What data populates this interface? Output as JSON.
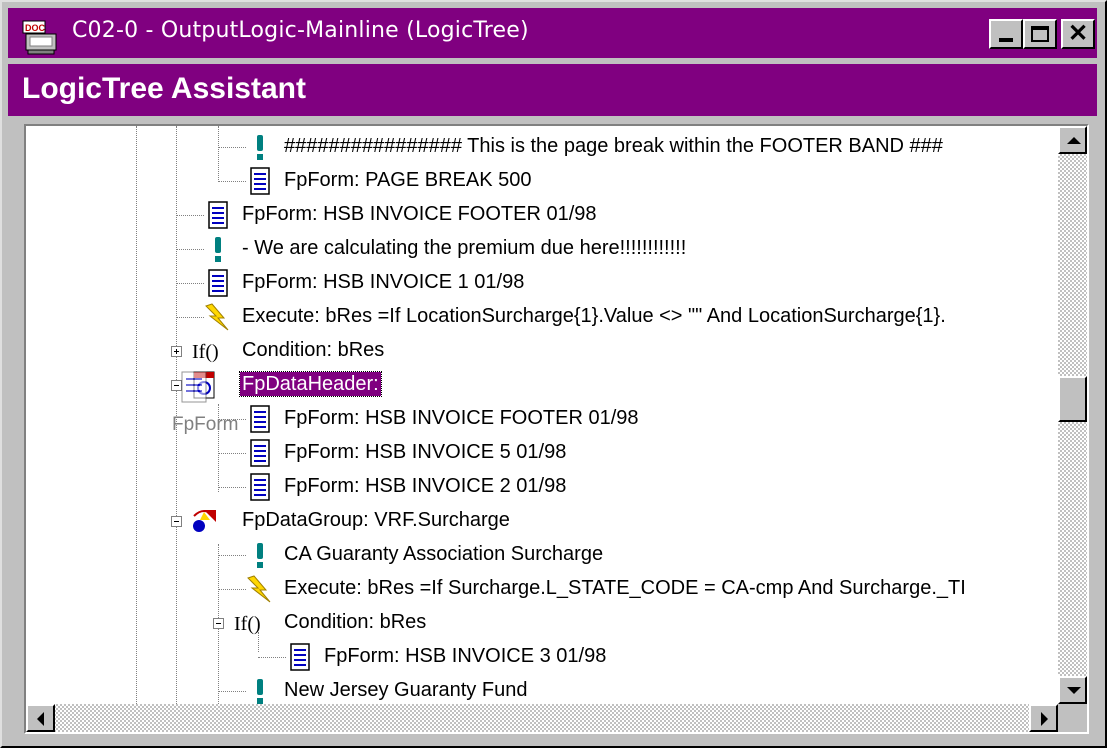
{
  "window": {
    "title": "C02-0 - OutputLogic-Mainline (LogicTree)",
    "title_bar_color": "#800080",
    "app_icon": "doc-icon"
  },
  "header": {
    "title": "LogicTree Assistant"
  },
  "tree": {
    "selection_color": "#800080",
    "drag_ghost_label": "FpForm",
    "items": [
      {
        "label": "################ This is the page break within the FOOTER BAND ###",
        "icon": "exclamation-icon"
      },
      {
        "label": "FpForm: PAGE BREAK 500",
        "icon": "form-page-icon"
      },
      {
        "label": "FpForm: HSB INVOICE FOOTER 01/98",
        "icon": "form-page-icon"
      },
      {
        "label": "- We are calculating the premium due here!!!!!!!!!!!!",
        "icon": "exclamation-icon"
      },
      {
        "label": "FpForm: HSB INVOICE 1 01/98",
        "icon": "form-page-icon"
      },
      {
        "label": "Execute: bRes =If LocationSurcharge{1}.Value <> \"\" And LocationSurcharge{1}.",
        "icon": "lightning-icon"
      },
      {
        "label": "Condition: bRes",
        "icon": "condition-icon",
        "expander": "plus"
      },
      {
        "label": "FpDataHeader:",
        "icon": "data-header-icon",
        "expander": "minus",
        "selected": true
      },
      {
        "label": "FpForm: HSB INVOICE FOOTER 01/98",
        "icon": "form-page-icon"
      },
      {
        "label": "FpForm: HSB INVOICE 5 01/98",
        "icon": "form-page-icon"
      },
      {
        "label": "FpForm: HSB INVOICE 2 01/98",
        "icon": "form-page-icon"
      },
      {
        "label": "FpDataGroup: VRF.Surcharge",
        "icon": "data-group-icon",
        "expander": "minus"
      },
      {
        "label": "CA Guaranty Association Surcharge",
        "icon": "exclamation-icon"
      },
      {
        "label": "Execute: bRes =If Surcharge.L_STATE_CODE = CA-cmp And Surcharge._TI",
        "icon": "lightning-icon"
      },
      {
        "label": "Condition: bRes",
        "icon": "condition-icon",
        "expander": "minus"
      },
      {
        "label": "FpForm: HSB INVOICE 3 01/98",
        "icon": "form-page-icon"
      },
      {
        "label": "New Jersey Guaranty Fund",
        "icon": "exclamation-icon"
      }
    ]
  },
  "scrollbars": {
    "vertical": {
      "up_icon": "arrow-up-icon",
      "down_icon": "arrow-down-icon"
    },
    "horizontal": {
      "left_icon": "arrow-left-icon",
      "right_icon": "arrow-right-icon"
    }
  }
}
